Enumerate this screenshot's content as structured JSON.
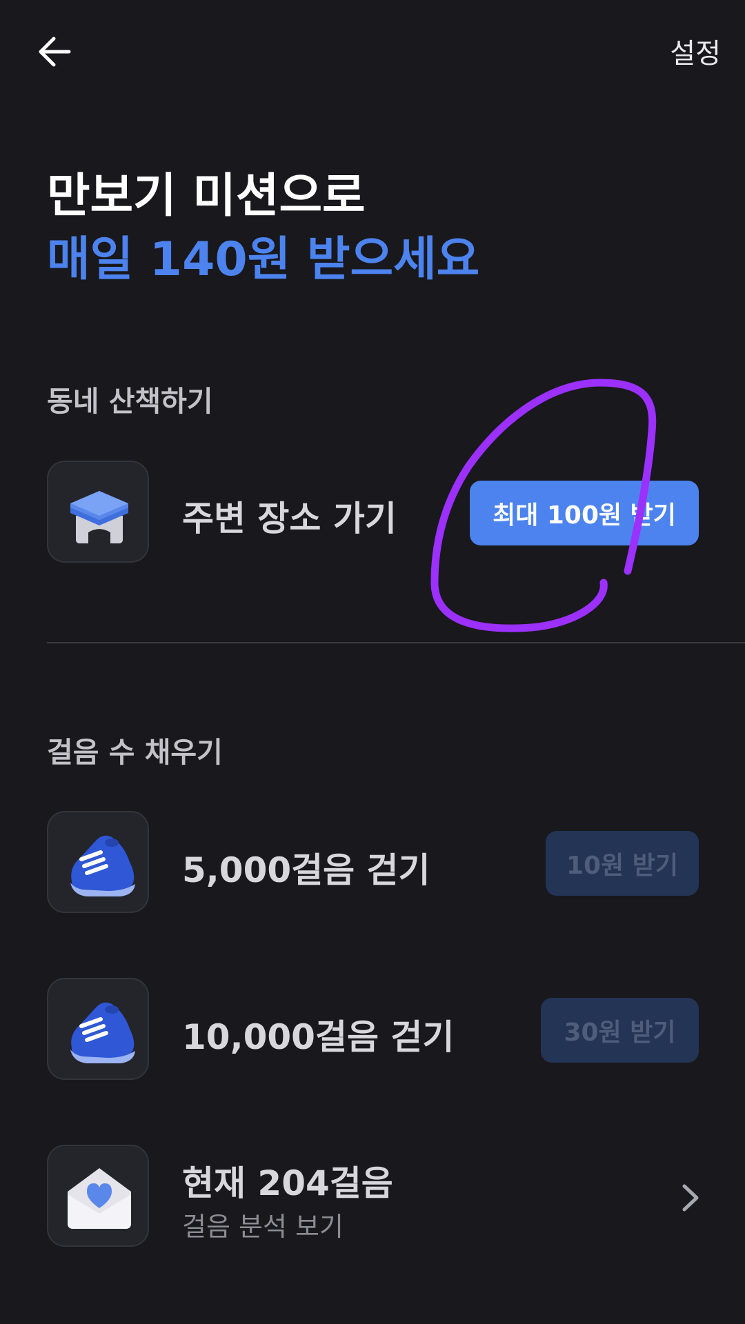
{
  "header": {
    "back_icon": "arrow-left-icon",
    "settings_label": "설정"
  },
  "title": {
    "line1": "만보기 미션으로",
    "line2": "매일 140원 받으세요",
    "line2_color": "#4c83ee"
  },
  "section_walk": {
    "heading": "동네 산책하기",
    "items": [
      {
        "icon": "map-pin-icon",
        "label": "주변 장소 가기",
        "button": "최대 100원 받기",
        "button_enabled": true
      }
    ]
  },
  "section_steps": {
    "heading": "걸음 수 채우기",
    "items": [
      {
        "icon": "sneaker-icon",
        "label": "5,000걸음 걷기",
        "button": "10원 받기",
        "button_enabled": false
      },
      {
        "icon": "sneaker-icon",
        "label": "10,000걸음 걷기",
        "button": "30원 받기",
        "button_enabled": false
      }
    ],
    "current": {
      "icon": "heart-envelope-icon",
      "label": "현재 204걸음",
      "sub_label": "걸음 분석 보기",
      "chevron_icon": "chevron-right-icon"
    }
  },
  "colors": {
    "background": "#18181d",
    "accent": "#4c83ee",
    "disabled_button": "#233455",
    "annotation": "#9b30ff"
  }
}
